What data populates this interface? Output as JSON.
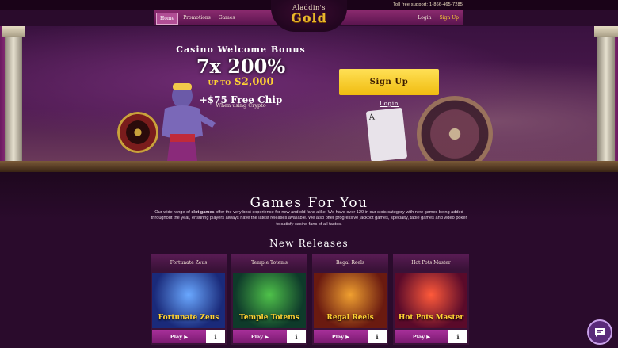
{
  "support": {
    "text": "Toll free support: 1-866-465-7285"
  },
  "nav": {
    "left": [
      {
        "label": "Home",
        "active": true
      },
      {
        "label": "Promotions",
        "active": false
      },
      {
        "label": "Games",
        "active": false
      }
    ],
    "right": [
      {
        "label": "Login"
      },
      {
        "label": "Sign Up"
      }
    ]
  },
  "logo": {
    "top": "Aladdin's",
    "bottom": "Gold"
  },
  "hero": {
    "title": "Casino Welcome Bonus",
    "main": "7x 200%",
    "upto_prefix": "UP TO",
    "upto_amount": "$2,000",
    "chip": "+$75 Free Chip",
    "chip_sub": "When using Crypto",
    "cta": "Sign Up",
    "login": "Login",
    "card_rank": "A"
  },
  "games": {
    "title": "Games For You",
    "description_pre": "Our wide range of ",
    "description_bold": "slot games",
    "description_post": " offer the very best experience for new and old fans alike. We have over 120 in our slots category with new games being added throughout the year, ensuring players always have the latest releases available. We also offer progressive jackpot games, specialty, table games and video poker to satisfy casino fans of all tastes."
  },
  "new_releases": {
    "title": "New Releases",
    "play_label": "Play ▶",
    "info_label": "i",
    "tiles": [
      {
        "name": "Fortunate Zeus",
        "art": "Fortunate Zeus"
      },
      {
        "name": "Temple Totems",
        "art": "Temple Totems"
      },
      {
        "name": "Regal Reels",
        "art": "Regal Reels"
      },
      {
        "name": "Hot Pots Master",
        "art": "Hot Pots Master"
      }
    ]
  },
  "colors": {
    "accent": "#ffd233",
    "nav": "#8a2a6e",
    "play": "#a8309a"
  },
  "icons": {
    "chat": "chat-bubble-icon",
    "play": "play-icon"
  }
}
